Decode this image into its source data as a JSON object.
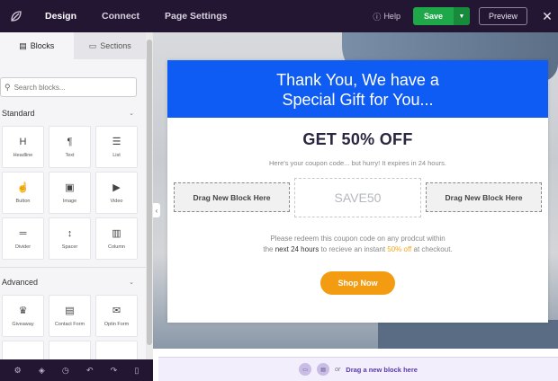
{
  "nav": {
    "items": [
      "Design",
      "Connect",
      "Page Settings"
    ],
    "help": "Help",
    "save": "Save",
    "preview": "Preview"
  },
  "sidebar": {
    "tabs": [
      "Blocks",
      "Sections"
    ],
    "search_placeholder": "Search blocks...",
    "standard_label": "Standard",
    "standard_blocks": [
      "Headline",
      "Text",
      "List",
      "Button",
      "Image",
      "Video",
      "Divider",
      "Spacer",
      "Column"
    ],
    "advanced_label": "Advanced",
    "advanced_blocks": [
      "Giveaway",
      "Contact Form",
      "Optin Form"
    ]
  },
  "card": {
    "header": "Thank You, We have a Special Gift for You...",
    "headline": "GET 50% OFF",
    "sub": "Here's your coupon code... but hurry! It expires in 24 hours.",
    "drag_left": "Drag New Block Here",
    "drag_right": "Drag New Block Here",
    "coupon": "SAVE50",
    "redeem_1": "Please redeem this coupon code on any prodcut within",
    "redeem_pre": "the",
    "redeem_hours": "next 24 hours",
    "redeem_mid": "to recieve an instant",
    "redeem_off": "50% off",
    "redeem_end": "at checkout.",
    "shop": "Shop Now"
  },
  "dropzone": {
    "or": "or",
    "label": "Drag a new block here"
  },
  "colors": {
    "brand": "#0f5cf4",
    "save": "#1ea84a",
    "accent": "#f39c12",
    "topbar": "#231633"
  }
}
